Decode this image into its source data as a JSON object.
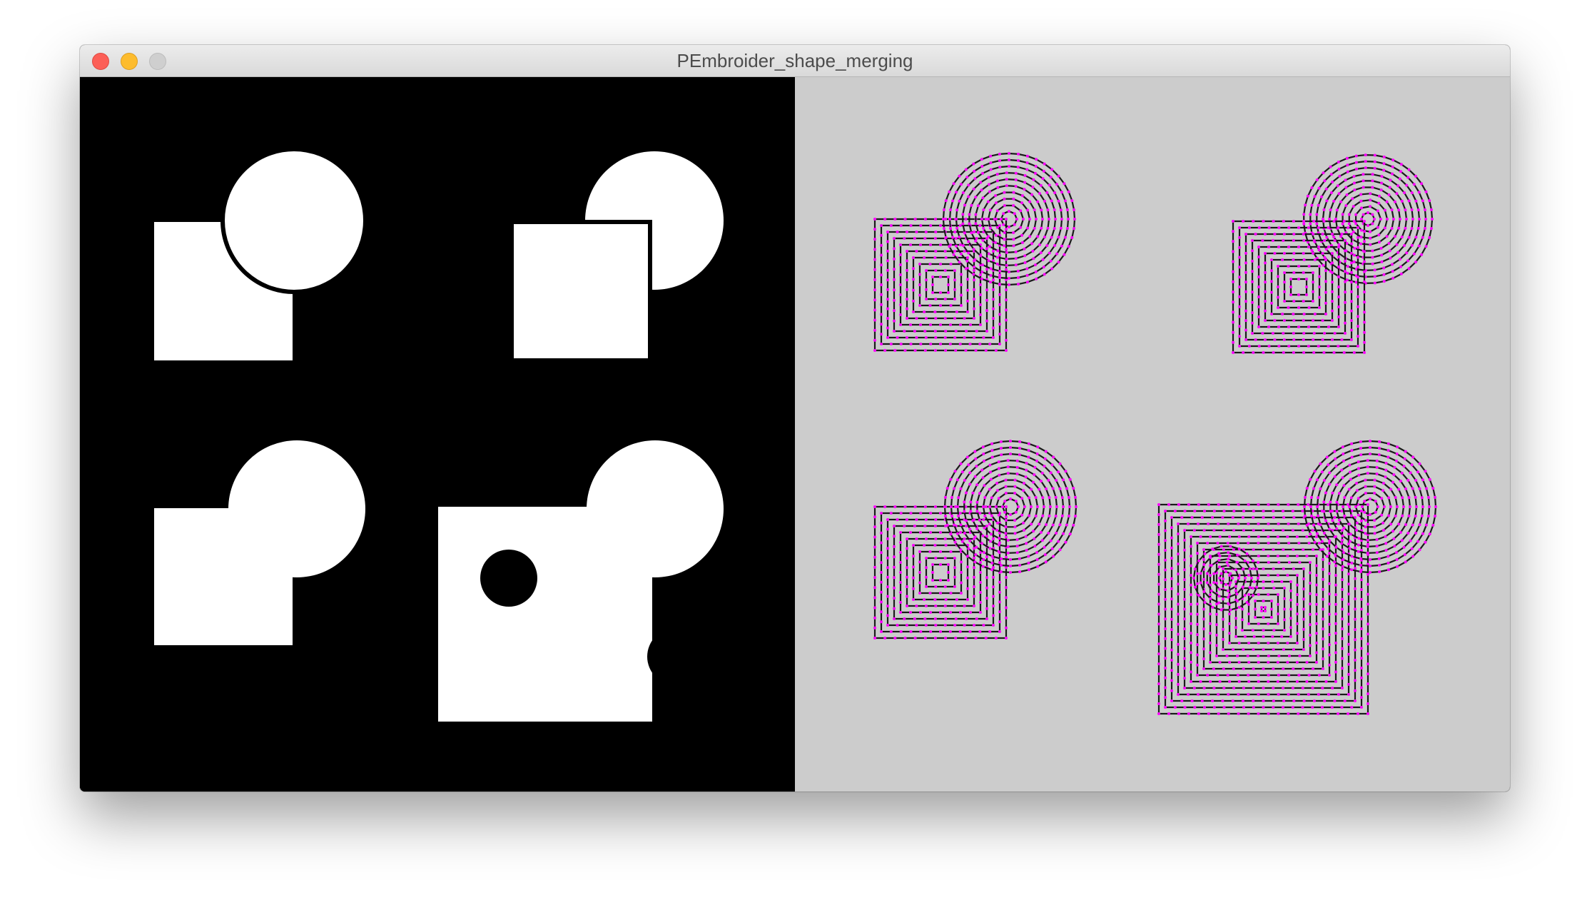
{
  "window": {
    "title": "PEmbroider_shape_merging"
  },
  "colors": {
    "left_background": "#000000",
    "shape_fill": "#ffffff",
    "right_background": "#cccccc",
    "stitch_line": "#1a1a1a",
    "stitch_point": "#ff00ff"
  },
  "icons": {
    "close": "close-dot",
    "minimize": "minimize-dot",
    "zoom": "zoom-dot"
  }
}
